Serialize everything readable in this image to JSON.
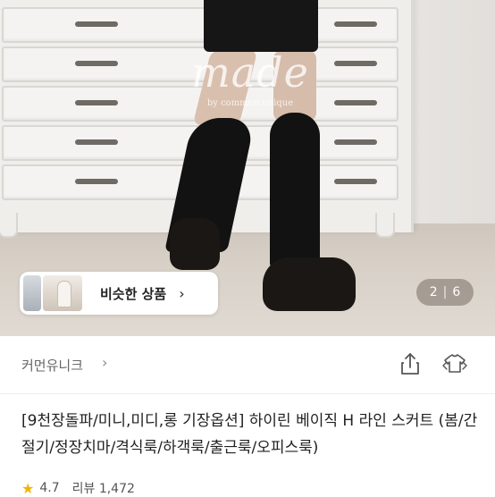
{
  "photo": {
    "watermark_big": "made",
    "watermark_small": "by common unique",
    "similar_label": "비슷한 상품",
    "pager_current": "2",
    "pager_total": "6"
  },
  "shop": {
    "name": "커먼유니크"
  },
  "product": {
    "title": "[9천장돌파/미니,미디,롱 기장옵션] 하이린 베이직 H 라인 스커트 (봄/간절기/정장치마/격식룩/하객룩/출근룩/오피스룩)",
    "rating": "4.7",
    "reviews": "리뷰 1,472"
  },
  "colors": {
    "star": "#f2b400"
  }
}
